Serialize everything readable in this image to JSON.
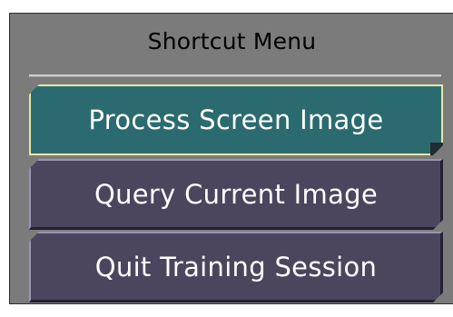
{
  "menu": {
    "title": "Shortcut Menu",
    "items": [
      {
        "label": "Process Screen Image",
        "state": "selected"
      },
      {
        "label": "Query Current Image",
        "state": "normal"
      },
      {
        "label": "Quit Training Session",
        "state": "normal"
      }
    ]
  },
  "colors": {
    "panel_background": "#7b7b7b",
    "button_normal": "#4b465e",
    "button_selected": "#2b6b6f",
    "selected_outline": "#e8e6a8",
    "button_text": "#ffffff",
    "title_text": "#000000"
  }
}
